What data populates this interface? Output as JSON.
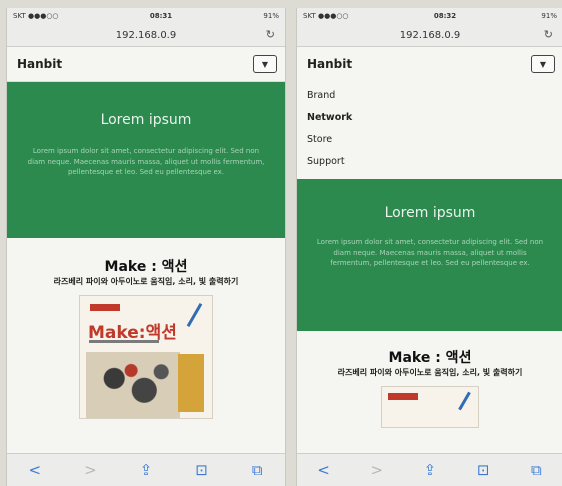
{
  "screens": [
    {
      "status": {
        "left": "SKT ●●●○○ ",
        "time": "08:31",
        "right": "91%"
      },
      "url": "192.168.0.9",
      "nav": {
        "brand": "Hanbit",
        "toggle_icon": "▼"
      },
      "hero": {
        "title": "Lorem ipsum",
        "text": "Lorem ipsum dolor sit amet, consectetur adipiscing elit. Sed non diam neque. Maecenas mauris massa, aliquet ut mollis fermentum, pellentesque et leo. Sed eu pellentesque ex."
      },
      "content": {
        "title": "Make : 액션",
        "subtitle": "라즈베리 파이와 아두이노로 움직임, 소리, 빛 출력하기"
      },
      "book": {
        "title": "Make:액션"
      }
    },
    {
      "status": {
        "left": "SKT ●●●○○ ",
        "time": "08:32",
        "right": "91%"
      },
      "url": "192.168.0.9",
      "nav": {
        "brand": "Hanbit",
        "toggle_icon": "▼"
      },
      "menu": [
        "Brand",
        "Network",
        "Store",
        "Support"
      ],
      "hero": {
        "title": "Lorem ipsum",
        "text": "Lorem ipsum dolor sit amet, consectetur adipiscing elit. Sed non diam neque. Maecenas mauris massa, aliquet ut mollis fermentum, pellentesque et leo. Sed eu pellentesque ex."
      },
      "content": {
        "title": "Make : 액션",
        "subtitle": "라즈베리 파이와 아두이노로 움직임, 소리, 빛 출력하기"
      }
    }
  ],
  "toolbar": {
    "back": "<",
    "forward": ">",
    "share": "⇪",
    "bookmarks": "⊡",
    "tabs": "⧉"
  },
  "colors": {
    "hero_green": "#2c8a4f",
    "link_blue": "#3b7bd6"
  }
}
